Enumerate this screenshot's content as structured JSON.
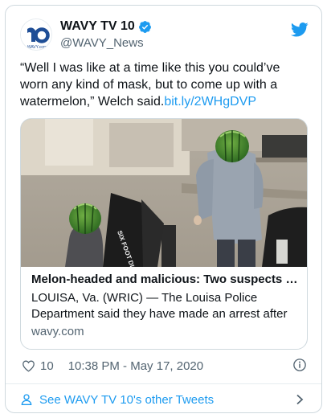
{
  "account": {
    "display_name": "WAVY TV 10",
    "handle": "@WAVY_News",
    "avatar_text": "WAVY.com",
    "verified_icon": "verified-badge-icon"
  },
  "tweet": {
    "text": "“Well I was like at a time like this you could’ve worn any kind of mask, but to come up with a watermelon,” Welch said.",
    "link_text": "bit.ly/2WHgDVP"
  },
  "link_card": {
    "sign_text": "SIX FOOT DISTANCE",
    "title": "Melon-headed and malicious: Two suspects ro...",
    "description": "LOUISA, Va. (WRIC) — The Louisa Police Department said they have made an arrest after",
    "domain": "wavy.com"
  },
  "meta": {
    "like_count": "10",
    "timestamp": "10:38 PM - May 17, 2020"
  },
  "footer": {
    "label": "See WAVY TV 10's other Tweets"
  },
  "colors": {
    "accent": "#1d9bf0",
    "secondary_text": "#536471",
    "border": "#cfd9de"
  }
}
